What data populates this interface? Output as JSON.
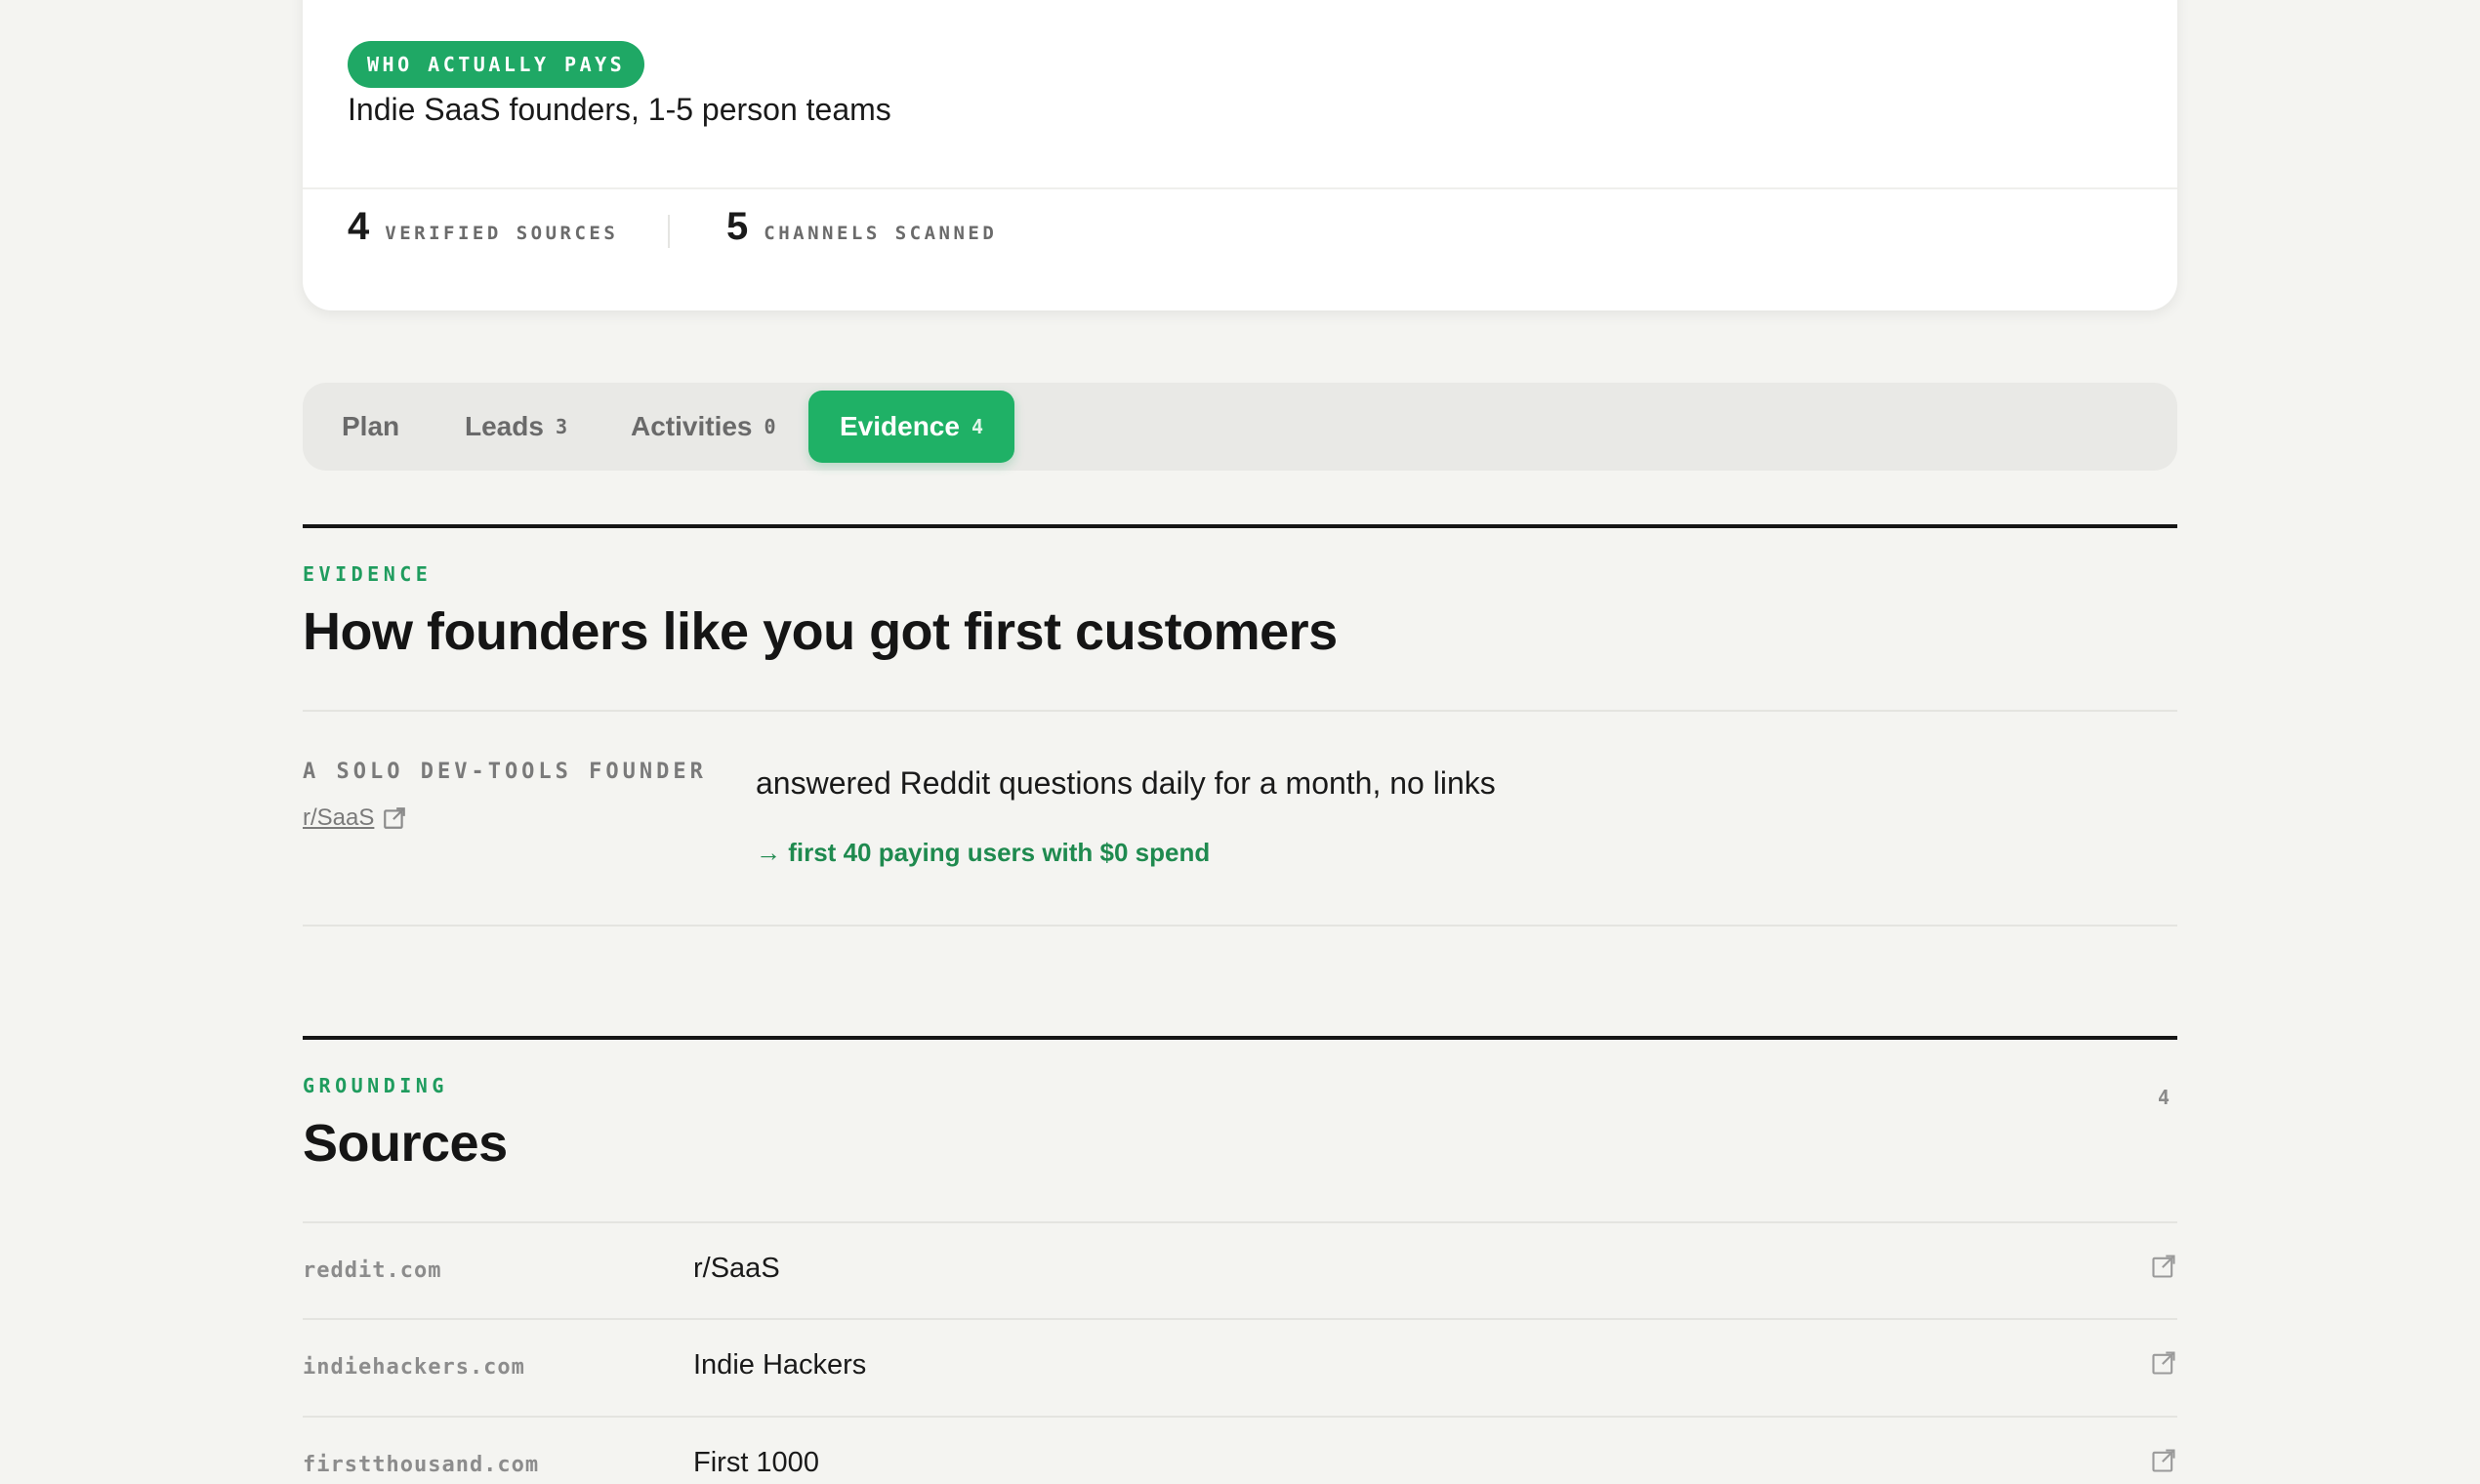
{
  "summary": {
    "badge": "WHO ACTUALLY PAYS",
    "audience": "Indie SaaS founders, 1-5 person teams",
    "stats": [
      {
        "value": "4",
        "label": "VERIFIED SOURCES"
      },
      {
        "value": "5",
        "label": "CHANNELS SCANNED"
      }
    ]
  },
  "tabs": [
    {
      "label": "Plan",
      "count": ""
    },
    {
      "label": "Leads",
      "count": "3"
    },
    {
      "label": "Activities",
      "count": "0"
    },
    {
      "label": "Evidence",
      "count": "4",
      "active": true
    }
  ],
  "evidence": {
    "eyebrow": "EVIDENCE",
    "title": "How founders like you got first customers",
    "items": [
      {
        "who": "A SOLO DEV-TOOLS FOUNDER",
        "source": "r/SaaS",
        "action": "answered Reddit questions daily for a month, no links",
        "result": "→ first 40 paying users with $0 spend"
      }
    ]
  },
  "grounding": {
    "eyebrow": "GROUNDING",
    "title": "Sources",
    "count": "4",
    "sources": [
      {
        "domain": "reddit.com",
        "name": "r/SaaS"
      },
      {
        "domain": "indiehackers.com",
        "name": "Indie Hackers"
      },
      {
        "domain": "firstthousand.com",
        "name": "First 1000"
      }
    ]
  },
  "colors": {
    "accent": "#1fb166",
    "accent_text": "#1f8a4f",
    "background": "#f4f4f1"
  }
}
